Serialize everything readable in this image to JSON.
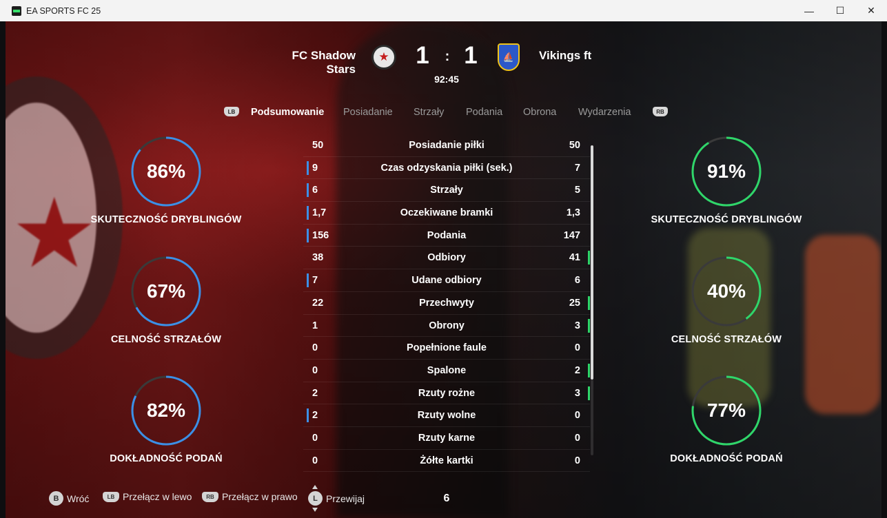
{
  "window": {
    "title": "EA SPORTS FC 25",
    "minimize": "—",
    "maximize": "☐",
    "close": "✕"
  },
  "match": {
    "home_team": "FC Shadow Stars",
    "away_team": "Vikings ft",
    "home_score": "1",
    "separator": ":",
    "away_score": "1",
    "clock": "92:45",
    "home_crest_icon": "★",
    "away_crest_icon": "⛵"
  },
  "colors": {
    "home_accent": "#3c8fe6",
    "away_accent": "#2fd66a",
    "ring_track": "#3a3a3a"
  },
  "tabs": {
    "left_bumper": "LB",
    "right_bumper": "RB",
    "items": [
      "Podsumowanie",
      "Posiadanie",
      "Strzały",
      "Podania",
      "Obrona",
      "Wydarzenia"
    ],
    "active_index": 0
  },
  "home_rings": [
    {
      "value": "86%",
      "fraction": 0.86,
      "label": "SKUTECZNOŚĆ DRYBLINGÓW"
    },
    {
      "value": "67%",
      "fraction": 0.67,
      "label": "CELNOŚĆ STRZAŁÓW"
    },
    {
      "value": "82%",
      "fraction": 0.82,
      "label": "DOKŁADNOŚĆ PODAŃ"
    }
  ],
  "away_rings": [
    {
      "value": "91%",
      "fraction": 0.91,
      "label": "SKUTECZNOŚĆ DRYBLINGÓW"
    },
    {
      "value": "40%",
      "fraction": 0.4,
      "label": "CELNOŚĆ STRZAŁÓW"
    },
    {
      "value": "77%",
      "fraction": 0.77,
      "label": "DOKŁADNOŚĆ PODAŃ"
    }
  ],
  "stats": [
    {
      "name": "Posiadanie piłki",
      "home": "50",
      "away": "50",
      "leader": "none"
    },
    {
      "name": "Czas odzyskania piłki (sek.)",
      "home": "9",
      "away": "7",
      "leader": "home"
    },
    {
      "name": "Strzały",
      "home": "6",
      "away": "5",
      "leader": "home"
    },
    {
      "name": "Oczekiwane bramki",
      "home": "1,7",
      "away": "1,3",
      "leader": "home"
    },
    {
      "name": "Podania",
      "home": "156",
      "away": "147",
      "leader": "home"
    },
    {
      "name": "Odbiory",
      "home": "38",
      "away": "41",
      "leader": "away"
    },
    {
      "name": "Udane odbiory",
      "home": "7",
      "away": "6",
      "leader": "home"
    },
    {
      "name": "Przechwyty",
      "home": "22",
      "away": "25",
      "leader": "away"
    },
    {
      "name": "Obrony",
      "home": "1",
      "away": "3",
      "leader": "away"
    },
    {
      "name": "Popełnione faule",
      "home": "0",
      "away": "0",
      "leader": "none"
    },
    {
      "name": "Spalone",
      "home": "0",
      "away": "2",
      "leader": "away"
    },
    {
      "name": "Rzuty rożne",
      "home": "2",
      "away": "3",
      "leader": "away"
    },
    {
      "name": "Rzuty wolne",
      "home": "2",
      "away": "0",
      "leader": "home"
    },
    {
      "name": "Rzuty karne",
      "home": "0",
      "away": "0",
      "leader": "none"
    },
    {
      "name": "Żółte kartki",
      "home": "0",
      "away": "0",
      "leader": "none"
    }
  ],
  "footer": {
    "back_glyph": "B",
    "back_label": "Wróć",
    "left_glyph": "LB",
    "left_label": "Przełącz w lewo",
    "right_glyph": "RB",
    "right_label": "Przełącz w prawo",
    "scroll_glyph": "L",
    "scroll_label": "Przewijaj",
    "page_number": "6"
  }
}
